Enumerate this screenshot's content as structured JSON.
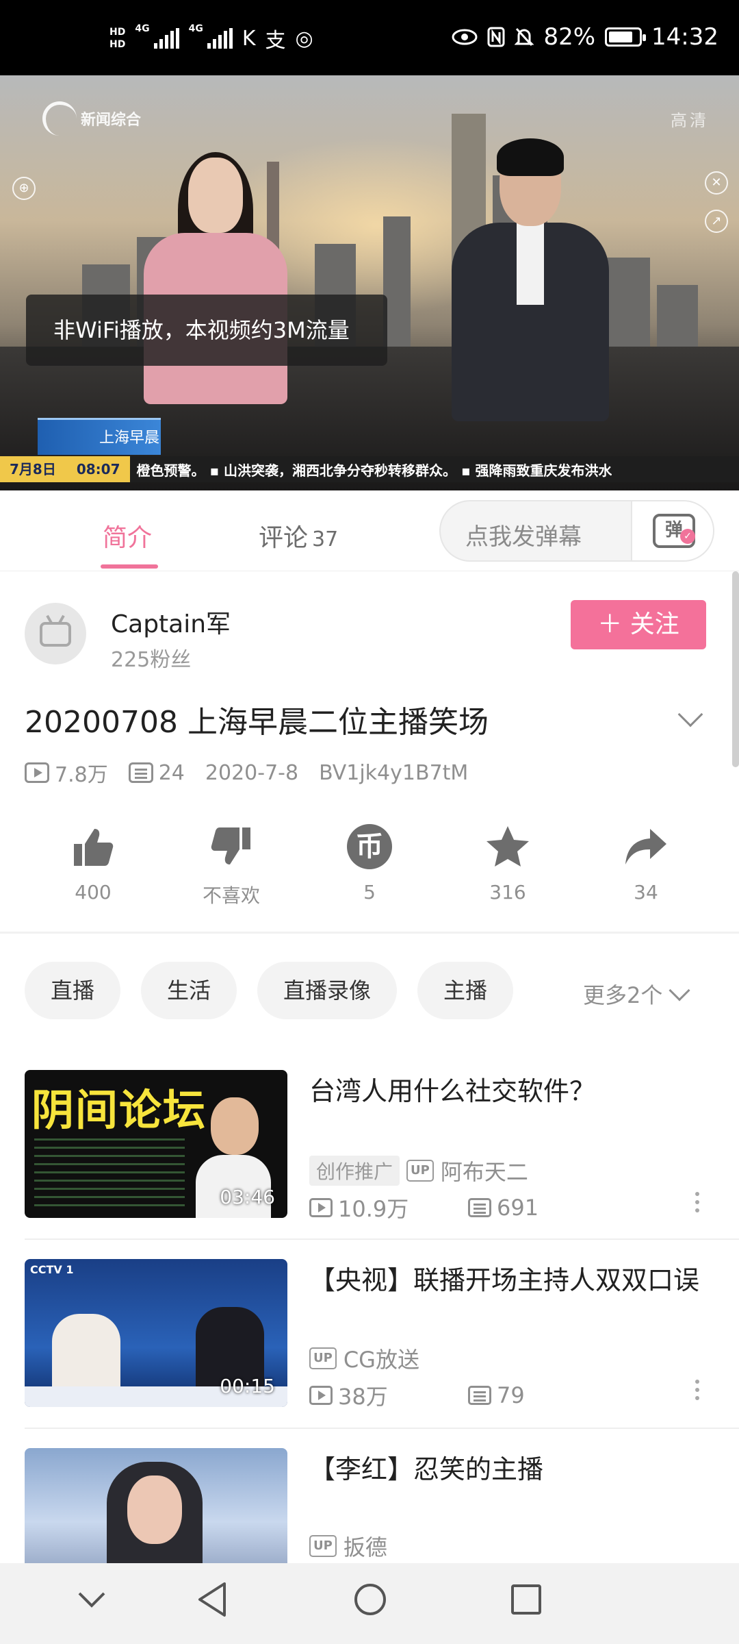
{
  "status_bar": {
    "hd_top": "HD",
    "hd_bottom": "HD",
    "net1": "4G",
    "net2": "4G",
    "battery": "82%",
    "battery_level": 0.82,
    "time": "14:32",
    "icons": [
      "hd-icon",
      "signal-icon",
      "signal-icon",
      "k-app-icon",
      "alipay-icon",
      "camera-icon",
      "eye-icon",
      "nfc-icon",
      "mute-icon",
      "battery-icon"
    ]
  },
  "video": {
    "channel_logo": "新闻综合",
    "quality": "高清",
    "toast": "非WiFi播放，本视频约3M流量",
    "program_logo": "上海早晨",
    "ticker_date": "7月8日",
    "ticker_time": "08:07",
    "ticker_text": "橙色预警。  ▪ 山洪突袭，湘西北争分夺秒转移群众。  ▪ 强降雨致重庆发布洪水"
  },
  "tabs": {
    "intro": "简介",
    "comments": "评论",
    "comments_count": "37",
    "danmaku_placeholder": "点我发弹幕",
    "danmaku_button": "弹"
  },
  "uploader": {
    "name": "Captain军",
    "fans": "225粉丝",
    "follow_label": "＋ 关注"
  },
  "video_info": {
    "title": "20200708 上海早晨二位主播笑场",
    "views": "7.8万",
    "danmaku": "24",
    "date": "2020-7-8",
    "bvid": "BV1jk4y1B7tM"
  },
  "actions": {
    "like": "400",
    "dislike": "不喜欢",
    "coin": "5",
    "favorite": "316",
    "share": "34",
    "coin_glyph": "币"
  },
  "tags": {
    "items": [
      "直播",
      "生活",
      "直播录像",
      "主播"
    ],
    "more": "更多2个"
  },
  "related": [
    {
      "thumb_text": "阴间论坛",
      "duration": "03:46",
      "title": "台湾人用什么社交软件？",
      "promo": "创作推广",
      "up_badge": "UP",
      "uploader": "阿布天二",
      "views": "10.9万",
      "danmaku": "691"
    },
    {
      "thumb_text": "CCTV 1",
      "duration": "00:15",
      "title": "【央视】联播开场主持人双双口误",
      "up_badge": "UP",
      "uploader": "CG放送",
      "views": "38万",
      "danmaku": "79"
    },
    {
      "title": "【李红】忍笑的主播",
      "up_badge": "UP",
      "uploader": "扳德"
    }
  ],
  "nav": {
    "icons": [
      "chevron-down-icon",
      "back-icon",
      "home-icon",
      "recents-icon"
    ]
  },
  "colors": {
    "accent": "#f4719a",
    "status_bar": "#000000",
    "muted_text": "#8f8f8f"
  }
}
